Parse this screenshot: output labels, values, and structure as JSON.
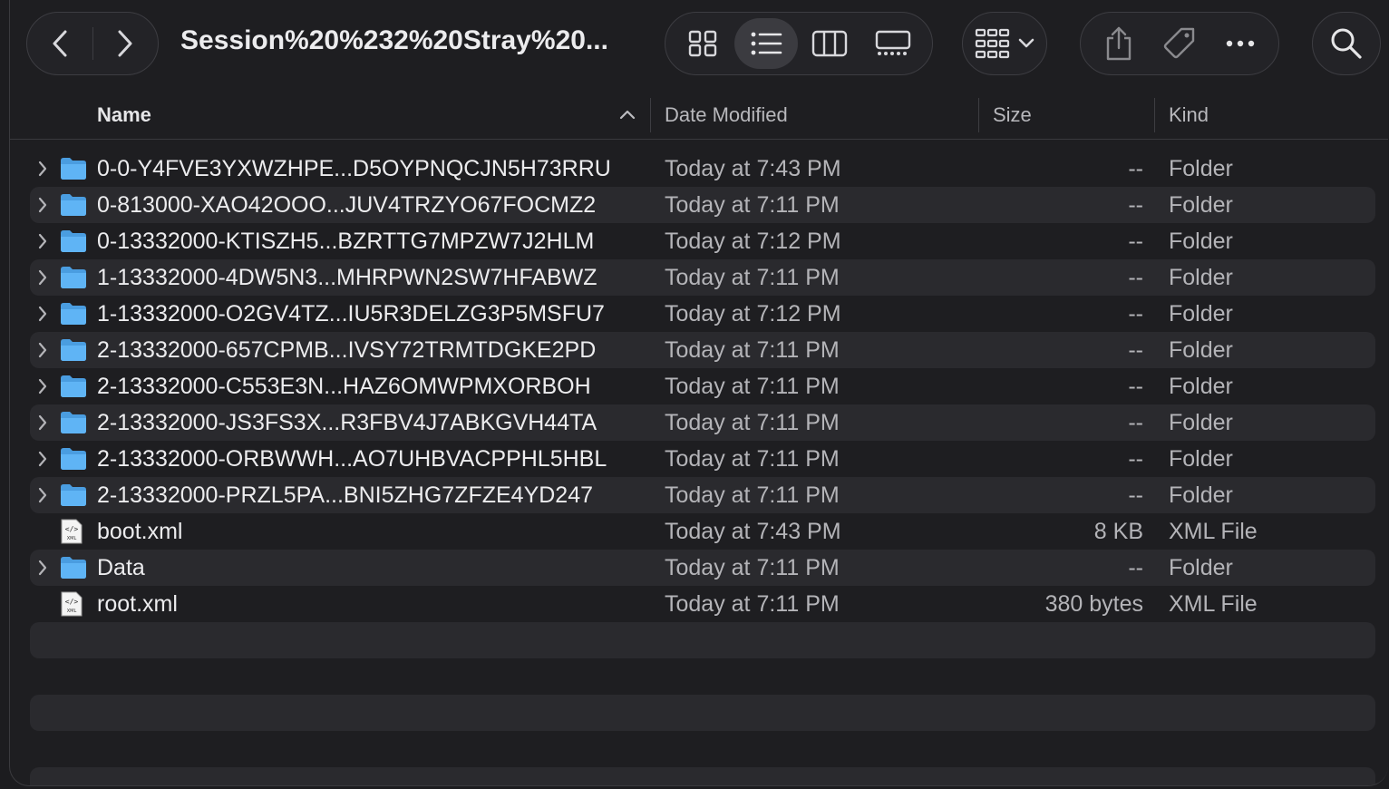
{
  "window": {
    "title": "Session%20%232%20Stray%20..."
  },
  "columns": {
    "name": "Name",
    "date": "Date Modified",
    "size": "Size",
    "kind": "Kind"
  },
  "icons": {
    "back": "chevron-left-icon",
    "forward": "chevron-right-icon",
    "icon_view": "grid-icon",
    "list_view": "list-icon",
    "column_view": "columns-icon",
    "gallery_view": "gallery-icon",
    "group": "group-icon",
    "share": "share-icon",
    "tag": "tag-icon",
    "more": "ellipsis-icon",
    "search": "search-icon"
  },
  "files": [
    {
      "name": "0-0-Y4FVE3YXWZHPE...D5OYPNQCJN5H73RRU",
      "date": "Today at 7:43 PM",
      "size": "--",
      "kind": "Folder",
      "type": "folder"
    },
    {
      "name": "0-813000-XAO42OOO...JUV4TRZYO67FOCMZ2",
      "date": "Today at 7:11 PM",
      "size": "--",
      "kind": "Folder",
      "type": "folder"
    },
    {
      "name": "0-13332000-KTISZH5...BZRTTG7MPZW7J2HLM",
      "date": "Today at 7:12 PM",
      "size": "--",
      "kind": "Folder",
      "type": "folder"
    },
    {
      "name": "1-13332000-4DW5N3...MHRPWN2SW7HFABWZ",
      "date": "Today at 7:11 PM",
      "size": "--",
      "kind": "Folder",
      "type": "folder"
    },
    {
      "name": "1-13332000-O2GV4TZ...IU5R3DELZG3P5MSFU7",
      "date": "Today at 7:12 PM",
      "size": "--",
      "kind": "Folder",
      "type": "folder"
    },
    {
      "name": "2-13332000-657CPMB...IVSY72TRMTDGKE2PD",
      "date": "Today at 7:11 PM",
      "size": "--",
      "kind": "Folder",
      "type": "folder"
    },
    {
      "name": "2-13332000-C553E3N...HAZ6OMWPMXORBOH",
      "date": "Today at 7:11 PM",
      "size": "--",
      "kind": "Folder",
      "type": "folder"
    },
    {
      "name": "2-13332000-JS3FS3X...R3FBV4J7ABKGVH44TA",
      "date": "Today at 7:11 PM",
      "size": "--",
      "kind": "Folder",
      "type": "folder"
    },
    {
      "name": "2-13332000-ORBWWH...AO7UHBVACPPHL5HBL",
      "date": "Today at 7:11 PM",
      "size": "--",
      "kind": "Folder",
      "type": "folder"
    },
    {
      "name": "2-13332000-PRZL5PA...BNI5ZHG7ZFZE4YD247",
      "date": "Today at 7:11 PM",
      "size": "--",
      "kind": "Folder",
      "type": "folder"
    },
    {
      "name": "boot.xml",
      "date": "Today at 7:43 PM",
      "size": "8 KB",
      "kind": "XML File",
      "type": "xml"
    },
    {
      "name": "Data",
      "date": "Today at 7:11 PM",
      "size": "--",
      "kind": "Folder",
      "type": "folder"
    },
    {
      "name": "root.xml",
      "date": "Today at 7:11 PM",
      "size": "380 bytes",
      "kind": "XML File",
      "type": "xml"
    }
  ],
  "colors": {
    "folder": "#5fb4f5",
    "background": "#1e1e21",
    "row_alt": "#2a2a2e"
  }
}
